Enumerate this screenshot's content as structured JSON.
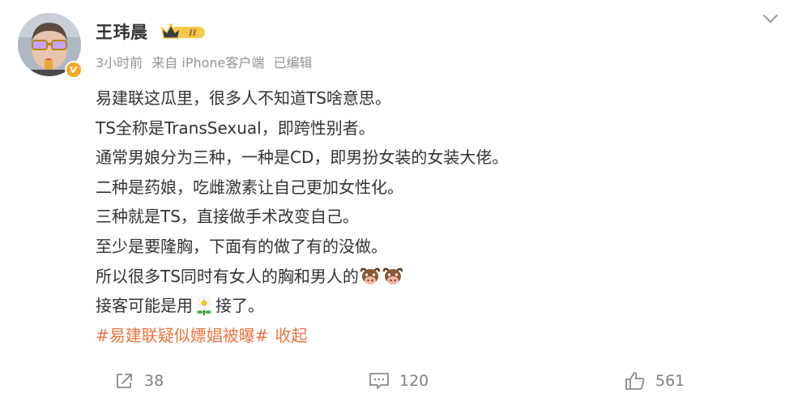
{
  "author": {
    "name": "王玮晨",
    "vip_level": "II"
  },
  "meta": {
    "time": "3小时前",
    "source": "来自 iPhone客户端",
    "edited": "已编辑"
  },
  "content": {
    "line1": "易建联这瓜里，很多人不知道TS啥意思。",
    "line2": "TS全称是TransSexual，即跨性别者。",
    "line3": "通常男娘分为三种，一种是CD，即男扮女装的女装大佬。",
    "line4": "二种是药娘，吃雌激素让自己更加女性化。",
    "line5": "三种就是TS，直接做手术改变自己。",
    "line6": "至少是要隆胸，下面有的做了有的没做。",
    "line7": "所以很多TS同时有女人的胸和男人的",
    "line8_before": "接客可能是用",
    "line8_after": "接了。",
    "hashtag": "#易建联疑似嫖娼被曝#",
    "collapse_label": "收起"
  },
  "icons": {
    "line7_emoji": "cow-face-icon",
    "line8_emoji": "flower-icon",
    "verified": "verified-badge-icon",
    "vip": "crown-vip-icon",
    "menu": "chevron-down-icon"
  },
  "actions": {
    "share_count": "38",
    "comment_count": "120",
    "like_count": "561"
  },
  "colors": {
    "text": "#333333",
    "meta": "#939393",
    "hashtag": "#eb7340",
    "action": "#808080",
    "verified": "#f5a623"
  }
}
